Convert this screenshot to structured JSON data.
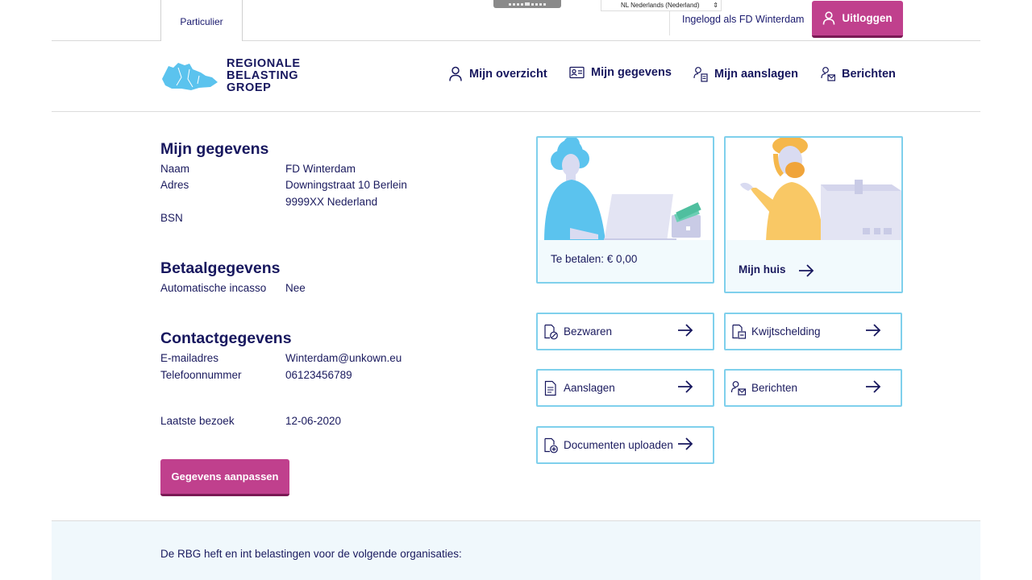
{
  "topbar": {
    "tab_label": "Particulier",
    "language_select": "NL Nederlands (Nederland)",
    "login_status": "Ingelogd als FD Winterdam",
    "logout_label": "Uitloggen"
  },
  "logo": {
    "line1": "REGIONALE",
    "line2": "BELASTING",
    "line3": "GROEP",
    "color": "#5bc3ee"
  },
  "nav": {
    "items": [
      {
        "label": "Mijn overzicht",
        "icon": "user-icon"
      },
      {
        "label": "Mijn gegevens",
        "icon": "id-card-icon"
      },
      {
        "label": "Mijn aanslagen",
        "icon": "user-document-icon"
      },
      {
        "label": "Berichten",
        "icon": "user-mail-icon"
      }
    ]
  },
  "gegevens": {
    "title": "Mijn gegevens",
    "naam_label": "Naam",
    "naam_value": "FD Winterdam",
    "adres_label": "Adres",
    "adres_line1": "Downingstraat 10 Berlein",
    "adres_line2": "9999XX Nederland",
    "bsn_label": "BSN",
    "bsn_value": ""
  },
  "betaal": {
    "title": "Betaalgegevens",
    "incasso_label": "Automatische incasso",
    "incasso_value": "Nee"
  },
  "contact": {
    "title": "Contactgegevens",
    "email_label": "E-mailadres",
    "email_value": "Winterdam@unkown.eu",
    "phone_label": "Telefoonnummer",
    "phone_value": "06123456789",
    "visit_label": "Laatste bezoek",
    "visit_value": "12-06-2020"
  },
  "edit_button": "Gegevens aanpassen",
  "cards": {
    "betalen": "Te betalen: € 0,00",
    "huis": "Mijn huis"
  },
  "tiles": {
    "bezwaren": "Bezwaren",
    "kwijtschelding": "Kwijtschelding",
    "aanslagen": "Aanslagen",
    "berichten": "Berichten",
    "uploaden": "Documenten uploaden"
  },
  "footer": {
    "text": "De RBG heft en int belastingen voor de volgende organisaties:"
  },
  "colors": {
    "primary": "#c0408d",
    "navy": "#17175e",
    "border": "#7fd0ec"
  }
}
